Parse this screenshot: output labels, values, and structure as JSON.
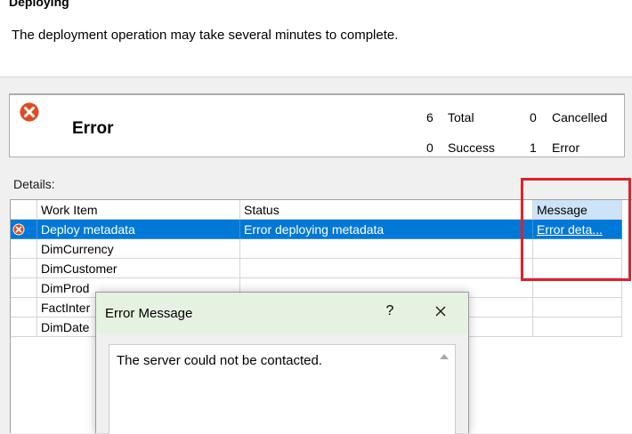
{
  "header": {
    "title": "Deploying",
    "subtitle": "The deployment operation may take several minutes to complete."
  },
  "summary": {
    "status_icon": "error-circle-icon",
    "title": "Error",
    "total_count": "6",
    "total_label": "Total",
    "cancelled_count": "0",
    "cancelled_label": "Cancelled",
    "success_count": "0",
    "success_label": "Success",
    "error_count": "1",
    "error_label": "Error"
  },
  "details": {
    "label": "Details:",
    "columns": [
      "Work Item",
      "Status",
      "Message"
    ],
    "rows": [
      {
        "work_item": "Deploy metadata",
        "status": "Error deploying metadata",
        "message": "Error deta...",
        "icon": "error-circle-icon"
      },
      {
        "work_item": "DimCurrency",
        "status": "",
        "message": ""
      },
      {
        "work_item": "DimCustomer",
        "status": "",
        "message": ""
      },
      {
        "work_item": "DimProd",
        "status": "",
        "message": ""
      },
      {
        "work_item": "FactInter",
        "status": "",
        "message": ""
      },
      {
        "work_item": "DimDate",
        "status": "",
        "message": ""
      }
    ]
  },
  "dialog": {
    "title": "Error Message",
    "help_label": "?",
    "close_icon": "close-icon",
    "message": "The server could not be contacted."
  },
  "colors": {
    "selection": "#0078d7",
    "highlight": "#e0202a",
    "error_icon": "#e04a20",
    "dialog_titlebar": "#e6f2e1"
  }
}
